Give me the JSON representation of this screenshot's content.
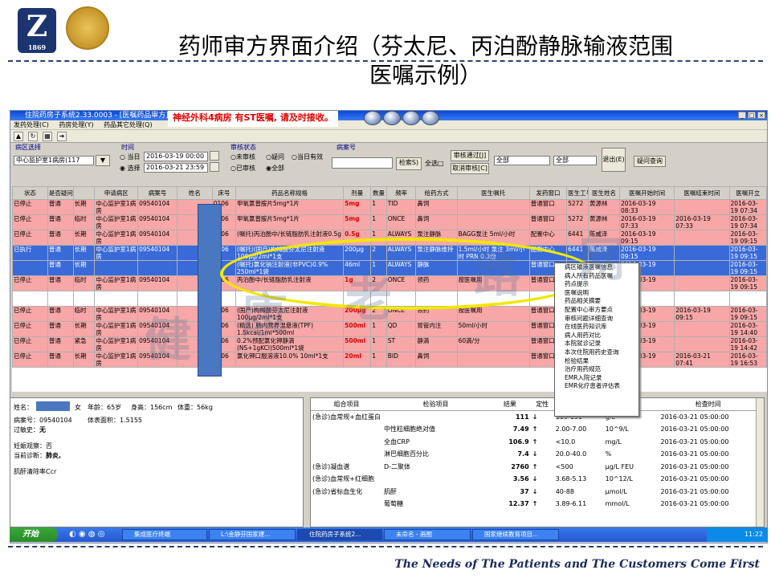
{
  "slide": {
    "title_line1": "药师审方界面介绍（芬太尼、丙泊酚静脉输液范围",
    "title_line2": "医嘱示例）",
    "logo_text": "Z",
    "logo_year": "1869",
    "slogan": "The Needs of The Patients and  The Customers Come First",
    "watermark": [
      "健",
      "康",
      "老",
      "路",
      "网"
    ]
  },
  "window": {
    "title": "住院药房子系统2.33.0003 - [医嘱药品审方]",
    "highlight": "神经外科4病房  有ST医嘱, 请及时接收。"
  },
  "menubar": [
    "发药处理(C)",
    "药房处理(Y)",
    "药品其它处理(Q)"
  ],
  "filters": {
    "ward_label": "病区选择",
    "ward_value": "中心监护室1病房(117",
    "time_label": "时间",
    "today": "当日",
    "select": "选择",
    "date_from": "2016-03-19 00:00",
    "date_to": "2016-03-21 23:59",
    "audit_label": "审核状态",
    "audit_options": [
      "未审核",
      "疑问",
      "当日有效",
      "已审核",
      "全部"
    ],
    "bed_label": "病案号",
    "search_btn": "检索S)",
    "select_all": "全选",
    "pass_btn": "审核通过[J]",
    "cancel_btn": "取消审核[C]",
    "combo1": "全部",
    "combo2": "全部",
    "exit_btn": "退出(E)",
    "query_btn": "疑问查询"
  },
  "grid": {
    "columns": [
      "状态",
      "是否疑问",
      "",
      "申请病区",
      "病案号",
      "姓名",
      "床号",
      "药品名称规格",
      "剂量",
      "数量",
      "频率",
      "给药方式",
      "医生嘱托",
      "发药窗口",
      "医生工号",
      "医生姓名",
      "医嘱开始时间",
      "医嘱结束时间",
      "医嘱开立"
    ],
    "rows": [
      {
        "style": "pink",
        "cells": [
          "已停止",
          "普通",
          "长期",
          "中心监护室1病房",
          "09540104",
          "",
          "0106",
          "甲氧氯普胺片5mg*1片",
          "5mg",
          "1",
          "TID",
          "鼻饲",
          "",
          "普通窗口",
          "5272",
          "黄源林",
          "2016-03-19 08:33",
          "",
          "2016-03-19 07:34"
        ]
      },
      {
        "style": "pink",
        "cells": [
          "已停止",
          "普通",
          "临时",
          "中心监护室1病房",
          "09540104",
          "",
          "0106",
          "甲氧氯普胺片5mg*1片",
          "5mg",
          "1",
          "ONCE",
          "鼻饲",
          "",
          "普通窗口",
          "5272",
          "黄源林",
          "2016-03-19 07:33",
          "2016-03-19 07:33",
          "2016-03-19 07:34"
        ]
      },
      {
        "style": "pink",
        "cells": [
          "已停止",
          "普通",
          "长期",
          "中心监护室1病房",
          "09540104",
          "",
          "0106",
          "(嘱托)丙泊酚中/长链脂肪乳注射液0.5g",
          "0.5g",
          "1",
          "ALWAYS",
          "泵注静脉",
          "BAGG泵注 5ml/小时",
          "配置中心",
          "6441",
          "陈威泽",
          "2016-03-19 09:15",
          "",
          "2016-03-19 09:15"
        ]
      },
      {
        "style": "blue",
        "cells": [
          "已执行",
          "普通",
          "长期",
          "中心监护室1病房",
          "09540104",
          "",
          "0106",
          "(嘱托)(国产)枸橼酸芬太尼注射液100μg/2ml*1支",
          "200μg",
          "2",
          "ALWAYS",
          "泵注静脉维持",
          "1.5ml/小时 泵注 3ml/小时 PRN 0.3份",
          "配置中心",
          "6441",
          "陈威泽",
          "2016-03-19 09:15",
          "",
          "2016-03-19 09:15"
        ]
      },
      {
        "style": "blue",
        "cells": [
          "",
          "普通",
          "长期",
          "",
          "",
          "",
          "",
          "(嘱托)氯化钠注射液(非PVC)0.9% 250ml*1袋",
          "46ml",
          "1",
          "ALWAYS",
          "静脉",
          "",
          "普通窗口",
          "",
          "",
          "2016-03-19 09:15",
          "",
          "2016-03-19 09:15"
        ]
      },
      {
        "style": "pink",
        "cells": [
          "已停止",
          "普通",
          "临时",
          "中心监护室1病房",
          "09540104",
          "",
          "0106",
          "丙泊酚中/长链脂肪乳注射液",
          "1g",
          "2",
          "ONCE",
          "领药",
          "按医嘱用",
          "普通窗口",
          "",
          "",
          "2016-03-19 09:15",
          "",
          "2016-03-19 09:15"
        ]
      },
      {
        "style": "white",
        "cells": [
          "",
          "",
          "",
          "",
          "",
          "",
          "",
          "",
          "",
          "",
          "",
          "",
          "",
          "",
          "",
          "",
          "",
          "",
          ""
        ]
      },
      {
        "style": "pink",
        "cells": [
          "已停止",
          "普通",
          "临时",
          "中心监护室1病房",
          "09540104",
          "",
          "0106",
          "(国产)枸橼酸芬太尼注射液100μg/2ml*1支",
          "200μg",
          "2",
          "ONCE",
          "领药",
          "按医嘱用",
          "普通窗口",
          "",
          "",
          "2016-03-19 09:15",
          "2016-03-19 09:15",
          "2016-03-19 09:15"
        ]
      },
      {
        "style": "pink",
        "cells": [
          "已停止",
          "普通",
          "长期",
          "中心监护室1病房",
          "09540104",
          "",
          "0106",
          "(精选) 肠内营养混悬液(TPF) 1.5kcal/1ml*500ml",
          "500ml",
          "1",
          "QD",
          "胃管内注",
          "50ml/小时",
          "普通窗口",
          "",
          "",
          "2016-03-19 14:39",
          "",
          "2016-03-19 14:40"
        ]
      },
      {
        "style": "pink",
        "cells": [
          "已停止",
          "普通",
          "紧急",
          "中心监护室1病房",
          "09540104",
          "",
          "0106",
          "0.2%预配氯化钾静滴(NS+1gKCl)500ml*1袋",
          "500ml",
          "1",
          "ST",
          "静滴",
          "60滴/分",
          "普通窗口",
          "",
          "",
          "2016-03-19 14:42",
          "",
          "2016-03-19 14:42"
        ]
      },
      {
        "style": "pink",
        "cells": [
          "已停止",
          "普通",
          "长期",
          "中心监护室1病房",
          "09540104",
          "",
          "0106",
          "氯化钾口服溶液10.0% 10ml*1支",
          "20ml",
          "1",
          "BID",
          "鼻饲",
          "",
          "普通窗口",
          "",
          "",
          "2016-03-19 16:53",
          "2016-03-21 07:41",
          "2016-03-19 16:53"
        ]
      }
    ]
  },
  "context_menu": [
    "病区输液医嘱信息",
    "病人所有药品医嘱",
    "药点提示",
    "医嘱说明",
    "药品相关摘要",
    "配置中心审方要点",
    "审核问题详细查询",
    "在线医药知识库",
    "病人用药对比",
    "本院就诊记录",
    "本次住院用药史查询",
    "检验结果",
    "治疗用药规范",
    "EMR入院记录",
    "EMR化疗患者评估表"
  ],
  "patient": {
    "name_label": "姓名：",
    "sex": "女",
    "age_label": "年龄：",
    "age": "65岁",
    "height_label": "身高：",
    "height": "156cm",
    "weight_label": "体重：",
    "weight": "56kg",
    "case_label": "病案号：",
    "case_no": "09540104",
    "bsa_label": "体表面积：",
    "bsa": "1.5155",
    "allergy_label": "过敏史：",
    "allergy": "无",
    "pregnancy_label": "妊娠观察：",
    "pregnancy": "否",
    "diag_label": "当前诊断：",
    "diagnosis": "肺炎,",
    "ccr_label": "肌酐清除率Ccr"
  },
  "lab": {
    "headers": [
      "组合项目",
      "检验项目",
      "结果",
      "定性",
      "参考值",
      "单位",
      "检查时间"
    ],
    "rows": [
      [
        "(急诊)血常规+血红蛋白",
        "",
        "111",
        "↓",
        "113-151",
        "g/L",
        "2016-03-21 05:00:00"
      ],
      [
        "",
        "中性粒细胞绝对值",
        "7.49",
        "↑",
        "2.00-7.00",
        "10^9/L",
        "2016-03-21 05:00:00"
      ],
      [
        "",
        "全血CRP",
        "106.9",
        "↑",
        "<10.0",
        "mg/L",
        "2016-03-21 05:00:00"
      ],
      [
        "",
        "淋巴细胞百分比",
        "7.4",
        "↓",
        "20.0-40.0",
        "%",
        "2016-03-21 05:00:00"
      ],
      [
        "(急诊)凝血谱",
        "D-二聚体",
        "2760",
        "↑",
        "<500",
        "μg/L FEU",
        "2016-03-21 05:00:00"
      ],
      [
        "(急诊)血常规+红细胞",
        "",
        "3.56",
        "↓",
        "3.68-5.13",
        "10^12/L",
        "2016-03-21 05:00:00"
      ],
      [
        "(急诊)省标血生化",
        "肌酐",
        "37",
        "↓",
        "40-88",
        "μmol/L",
        "2016-03-21 05:00:00"
      ],
      [
        "",
        "葡萄糖",
        "12.37",
        "↑",
        "3.89-6.11",
        "mmol/L",
        "2016-03-21 05:00:00"
      ]
    ]
  },
  "taskbar": {
    "start": "开始",
    "tasks": [
      "集成医疗终端",
      "L:\\金静芬国家建...",
      "住院药房子系统2...",
      "未命名 - 画图",
      "国家继续教育项目..."
    ],
    "time": "11:22"
  }
}
